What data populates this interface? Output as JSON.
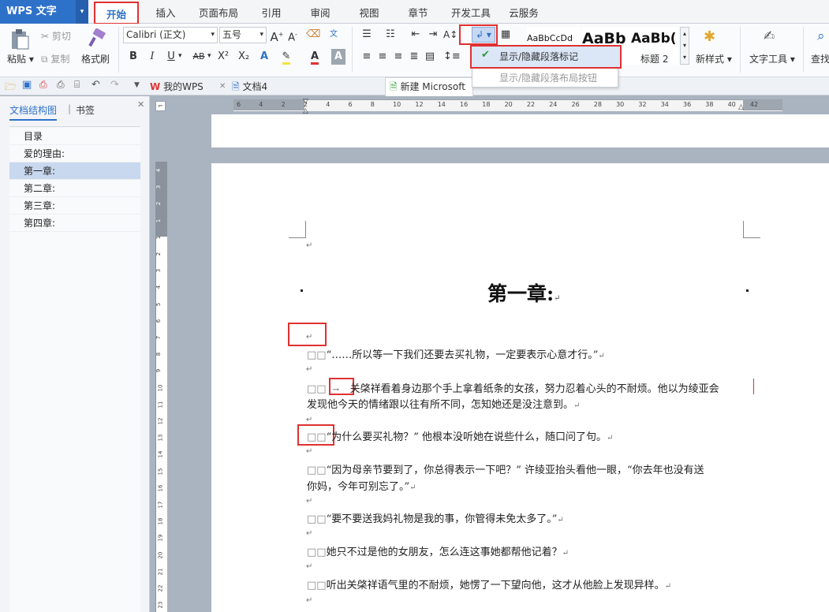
{
  "app": {
    "logo": "WPS 文字"
  },
  "menu": {
    "tabs": [
      "开始",
      "插入",
      "页面布局",
      "引用",
      "审阅",
      "视图",
      "章节",
      "开发工具",
      "云服务"
    ]
  },
  "ribbon": {
    "paste": "粘贴",
    "cut": "剪切",
    "copy": "复制",
    "format_painter": "格式刷",
    "font_name": "Calibri (正文)",
    "font_size": "五号",
    "bold": "B",
    "italic": "I",
    "underline": "U",
    "strike": "AB",
    "superscript": "X²",
    "subscript": "X₂",
    "styles": {
      "s1": "AaBbCcDd",
      "s2": "AaBb",
      "s3": "AaBb(",
      "h2": "标题 2"
    },
    "new_style": "新样式",
    "text_tools": "文字工具",
    "find": "查找"
  },
  "popup": {
    "item1": "显示/隐藏段落标记",
    "item2": "显示/隐藏段落布局按钮"
  },
  "docbar": {
    "wps_tab": "我的WPS",
    "doc4_tab": "文档4",
    "new_tab": "新建 Microsoft"
  },
  "left_panel": {
    "tab1": "文档结构图",
    "tab2": "书签",
    "items": [
      "目录",
      "爱的理由:",
      "第一章:",
      "第二章:",
      "第三章:",
      "第四章:"
    ]
  },
  "ruler": {
    "h_labels": [
      "6",
      "4",
      "2",
      "2",
      "4",
      "6",
      "8",
      "10",
      "12",
      "14",
      "16",
      "18",
      "20",
      "22",
      "24",
      "26",
      "28",
      "30",
      "32",
      "34",
      "36",
      "38",
      "40",
      "42"
    ],
    "v_labels": [
      "4",
      "3",
      "2",
      "1",
      "1",
      "2",
      "3",
      "4",
      "5",
      "6",
      "7",
      "8",
      "9",
      "10",
      "11",
      "12",
      "13",
      "14",
      "15",
      "16",
      "17",
      "18",
      "19",
      "20",
      "21",
      "22",
      "23"
    ]
  },
  "document": {
    "heading": "第一章:",
    "p1": "“……所以等一下我们还要去买礼物，一定要表示心意才行。”",
    "p2a": "关棨祥看着身边那个手上拿着纸条的女孩，努力忍着心头的不耐烦。他以为绫亚会",
    "p2b": "发现他今天的情绪跟以往有所不同，怎知她还是没注意到。",
    "p3": "“为什么要买礼物？” 他根本没听她在说些什么，随口问了句。",
    "p4a": "“因为母亲节要到了，你总得表示一下吧？” 许绫亚抬头看他一眼，“你去年也没有送",
    "p4b": "你妈，今年可别忘了。”",
    "p5": "“要不要送我妈礼物是我的事，你管得未免太多了。”",
    "p6": "她只不过是他的女朋友，怎么连这事她都帮他记着？",
    "p7": "听出关棨祥语气里的不耐烦，她愣了一下望向他，这才从他脸上发现异样。",
    "indent": "□□",
    "ret": "↵",
    "tabmark": "→"
  },
  "colors": {
    "accent": "#2e71c9",
    "highlight": "#e03131",
    "nav_selected": "#c8d8ef"
  }
}
